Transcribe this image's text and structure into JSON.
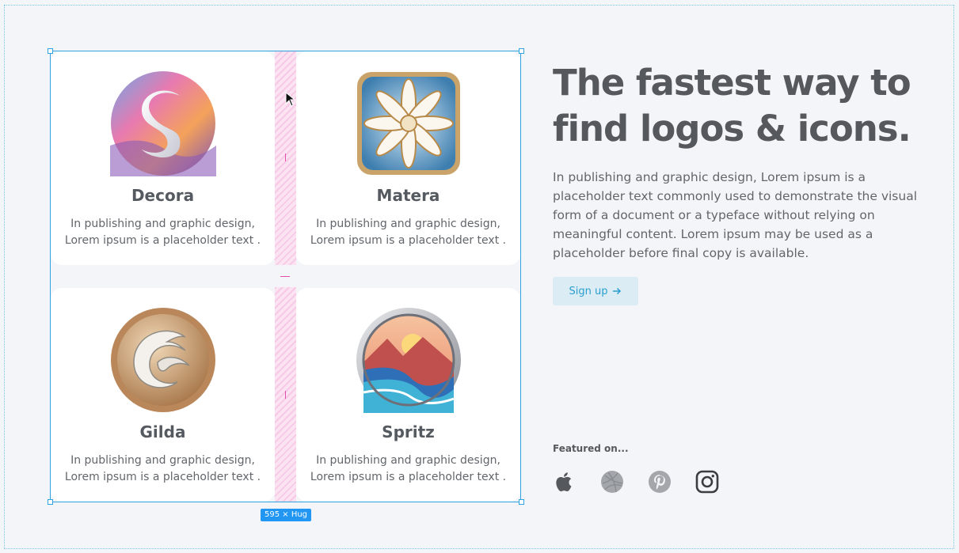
{
  "cards": [
    {
      "title": "Decora",
      "text": "In publishing and graphic design, Lorem ipsum is a placeholder text ."
    },
    {
      "title": "Matera",
      "text": "In publishing and graphic design, Lorem ipsum is a placeholder text ."
    },
    {
      "title": "Gilda",
      "text": "In publishing and graphic design, Lorem ipsum is a placeholder text ."
    },
    {
      "title": "Spritz",
      "text": "In publishing and graphic design, Lorem ipsum is a placeholder text ."
    }
  ],
  "hero": {
    "title": "The fastest way to find logos & icons.",
    "body": "In publishing and graphic design, Lorem ipsum is a placeholder text commonly used to demonstrate the visual form of a document or a typeface without relying on meaningful content. Lorem ipsum may be used as a placeholder before final copy is available.",
    "cta": "Sign up"
  },
  "featured": {
    "label": "Featured on...",
    "icons": [
      "apple-icon",
      "dribbble-icon",
      "pinterest-icon",
      "instagram-icon"
    ]
  },
  "selection": {
    "badge": "595 × Hug"
  },
  "colors": {
    "accent": "#2ea3e0",
    "gap": "#f7c9e7",
    "text": "#55585d"
  }
}
